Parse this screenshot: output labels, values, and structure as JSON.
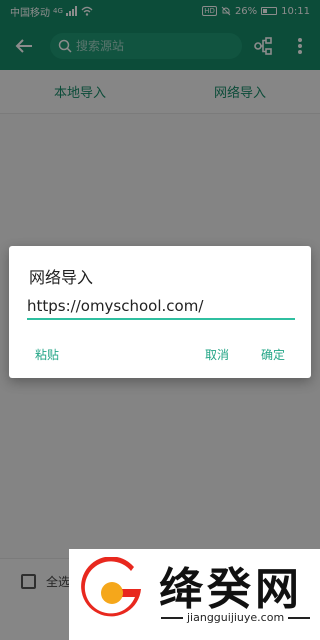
{
  "status_bar": {
    "carrier": "中国移动",
    "network": "4G",
    "hd": "HD",
    "battery": "26%",
    "time": "10:11"
  },
  "toolbar": {
    "search_placeholder": "搜索源站"
  },
  "tabs": [
    {
      "label": "本地导入"
    },
    {
      "label": "网络导入"
    }
  ],
  "bottom": {
    "select_all": "全选"
  },
  "dialog": {
    "title": "网络导入",
    "url_value": "https://omyschool.com/",
    "paste_label": "粘贴",
    "cancel_label": "取消",
    "ok_label": "确定"
  },
  "watermark": {
    "text": "绛癸网",
    "url": "jiangguijiuye.com"
  },
  "colors": {
    "primary": "#178a68",
    "accent": "#2fbfa0"
  }
}
